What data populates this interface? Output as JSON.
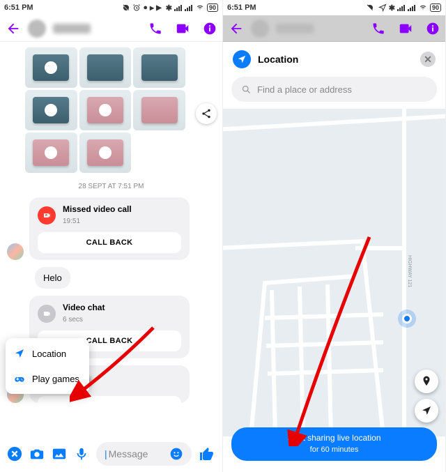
{
  "status": {
    "time": "6:51 PM",
    "battery": "90"
  },
  "left": {
    "timestamp": "28 SEPT AT 7:51 PM",
    "missed": {
      "title": "Missed video call",
      "time": "19:51"
    },
    "callback": "CALL BACK",
    "helo": "Helo",
    "videochat": {
      "title": "Video chat",
      "time": "6 secs"
    },
    "composer_placeholder": "Message",
    "popup": {
      "location": "Location",
      "games": "Play games"
    }
  },
  "right": {
    "location_title": "Location",
    "search_placeholder": "Find a place or address",
    "road_label": "HIGHWAY 121",
    "start_line1": "Start sharing live location",
    "start_line2": "for 60 minutes"
  }
}
